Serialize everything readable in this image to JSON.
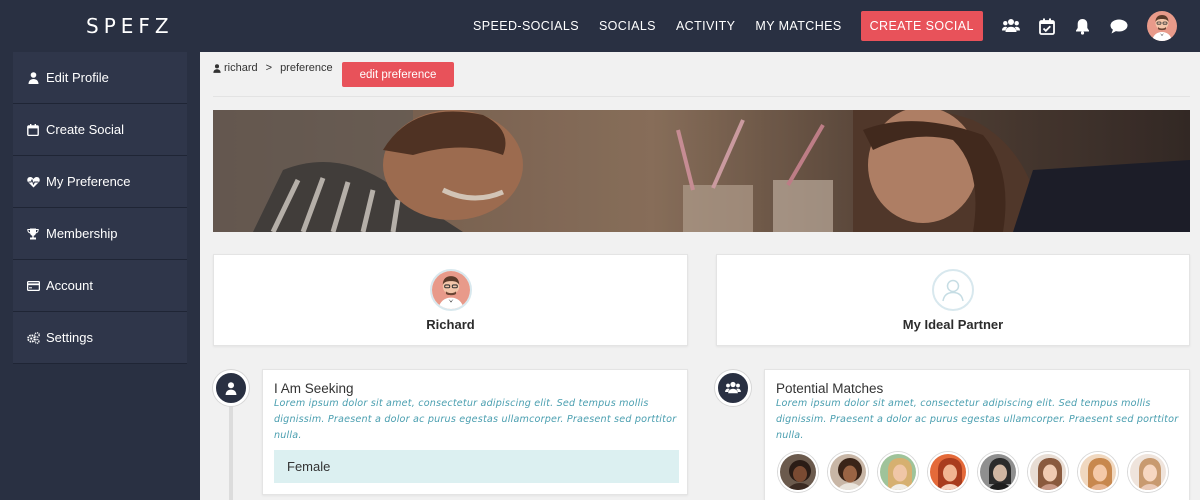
{
  "header": {
    "logo": "SPEFZ",
    "nav": [
      "SPEED-SOCIALS",
      "SOCIALS",
      "ACTIVITY",
      "MY MATCHES"
    ],
    "create_social": "CREATE SOCIAL",
    "icons": [
      "people-icon",
      "calendar-check-icon",
      "bell-icon",
      "chat-icon"
    ]
  },
  "sidebar": {
    "items": [
      {
        "label": "Edit Profile",
        "icon": "user-icon"
      },
      {
        "label": "Create Social",
        "icon": "calendar-icon"
      },
      {
        "label": "My Preference",
        "icon": "heart-pulse-icon"
      },
      {
        "label": "Membership",
        "icon": "trophy-icon"
      },
      {
        "label": "Account",
        "icon": "credit-card-icon"
      },
      {
        "label": "Settings",
        "icon": "gears-icon"
      }
    ]
  },
  "breadcrumb": {
    "user": "richard",
    "separator": ">",
    "page": "preference",
    "action": "edit preference"
  },
  "profile": {
    "me": "Richard",
    "partner": "My Ideal Partner"
  },
  "seeking": {
    "title": "I Am Seeking",
    "text": "Lorem ipsum dolor sit amet, consectetur adipiscing elit. Sed tempus mollis dignissim. Praesent a dolor ac purus egestas ullamcorper. Praesent sed porttitor nulla.",
    "value": "Female"
  },
  "matches": {
    "title": "Potential Matches",
    "text": "Lorem ipsum dolor sit amet, consectetur adipiscing elit. Sed tempus mollis dignissim. Praesent a dolor ac purus egestas ullamcorper. Praesent sed porttitor nulla.",
    "count": 8
  },
  "colors": {
    "navy": "#293042",
    "accent": "#e8525a",
    "teal_text": "#4b9fb0",
    "teal_bg": "#dcf0f1"
  }
}
